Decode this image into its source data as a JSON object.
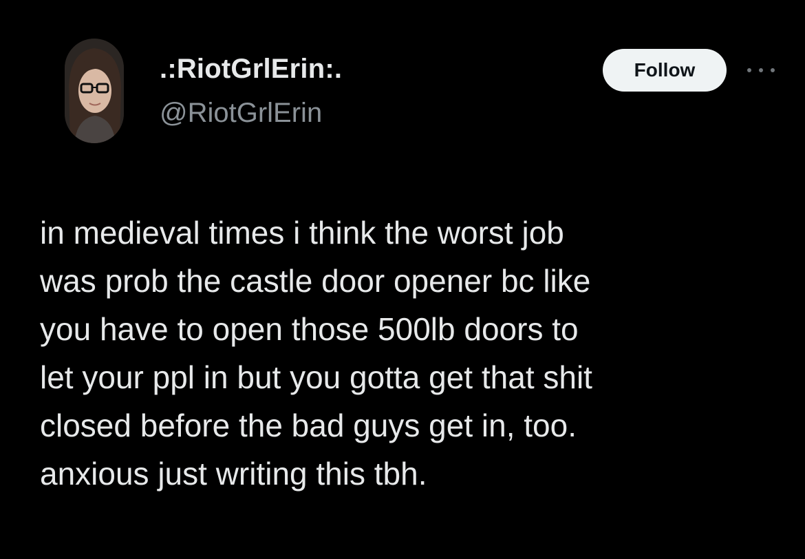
{
  "author": {
    "display_name": ".:RiotGrlErin:.",
    "handle": "@RiotGrlErin"
  },
  "actions": {
    "follow_label": "Follow",
    "more_icon": "more-horizontal-icon"
  },
  "tweet": {
    "lines": [
      "in medieval times i think the worst job",
      "was prob the castle door opener bc like",
      "you have to open those 500lb doors to",
      "let your ppl in but you gotta get that shit",
      "closed before the bad guys get in, too.",
      "anxious just writing this tbh."
    ]
  },
  "colors": {
    "background": "#000000",
    "text_primary": "#e7e9ea",
    "text_secondary": "#8b9298",
    "follow_bg": "#eff3f4",
    "follow_text": "#0f1419"
  }
}
